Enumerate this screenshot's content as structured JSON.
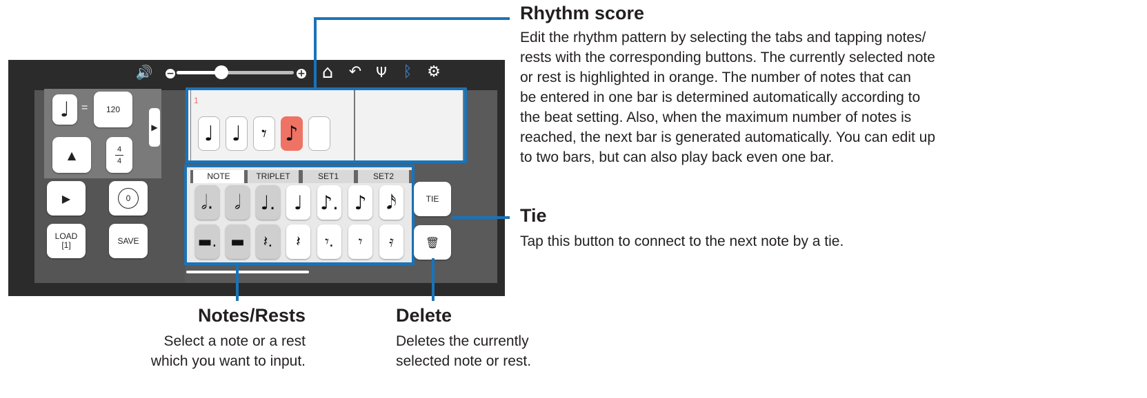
{
  "toolbar": {
    "icons": [
      "speaker-icon",
      "minus-icon",
      "volume-slider",
      "plus-icon",
      "home-icon",
      "undo-icon",
      "tuning-fork-icon",
      "bluetooth-icon",
      "gear-icon"
    ],
    "volume_level": 0.38,
    "speaker_glyph": "🔊",
    "minus_glyph": "−",
    "plus_glyph": "+",
    "home_glyph": "⌂",
    "undo_glyph": "↶",
    "fork_glyph": "Ψ",
    "bt_glyph": "ᛒ",
    "gear_glyph": "⚙"
  },
  "tempo": {
    "note_glyph": "♩",
    "equals": "=",
    "bpm": "120",
    "metronome_glyph": "▲",
    "time_sig_top": "4",
    "time_sig_bottom": "4",
    "expand_glyph": "▶"
  },
  "transport": {
    "play_glyph": "▶",
    "repeat_glyph": "⟳",
    "repeat_count": "0",
    "load_label": "LOAD\n[1]",
    "save_label": "SAVE"
  },
  "score": {
    "bar_number": "1",
    "notes": [
      {
        "glyph": "♩",
        "selected": false
      },
      {
        "glyph": "♩",
        "selected": false
      },
      {
        "glyph": "𝄾",
        "selected": false
      },
      {
        "glyph": "♪",
        "selected": true
      },
      {
        "glyph": "",
        "selected": false
      }
    ]
  },
  "palette": {
    "tabs": [
      "NOTE",
      "TRIPLET",
      "SET1",
      "SET2"
    ],
    "active_tab": 0,
    "notes": [
      "𝅗𝅥.",
      "𝅗𝅥",
      "♩.",
      "♩",
      "♪.",
      "♪",
      "𝅘𝅥𝅯"
    ],
    "rests": [
      "▬.",
      "▬",
      "𝄽.",
      "𝄽",
      "𝄾.",
      "𝄾",
      "𝄿"
    ],
    "grey_indices": [
      0,
      1,
      2
    ]
  },
  "side_buttons": {
    "tie_label": "TIE",
    "delete_glyph": "🗑"
  },
  "annotations": {
    "rhythm_title": "Rhythm score",
    "rhythm_lines": [
      "Edit the rhythm pattern by selecting the tabs and tapping notes/",
      "rests with the corresponding buttons. The currently selected note",
      "or rest is highlighted in orange. The number of notes that can",
      "be entered in one bar is determined automatically according to",
      "the beat setting. Also, when the maximum number of notes is",
      "reached, the next bar is generated automatically. You can edit up",
      "to two bars, but can also play back even one bar."
    ],
    "tie_title": "Tie",
    "tie_desc": "Tap this button to connect to the next note by a tie.",
    "notes_title": "Notes/Rests",
    "notes_lines": [
      "Select a note or a rest",
      "which you want to input."
    ],
    "delete_title": "Delete",
    "delete_lines": [
      "Deletes the currently",
      "selected note or rest."
    ]
  },
  "colors": {
    "accent_blue": "#1a73b8",
    "selected_orange": "#ef7364",
    "bluetooth_blue": "#3a8ee6"
  }
}
